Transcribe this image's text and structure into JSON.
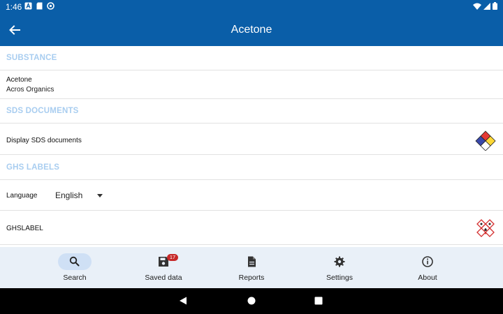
{
  "status_bar": {
    "time": "1:46"
  },
  "app_bar": {
    "title": "Acetone",
    "back_icon": "arrow-back-icon"
  },
  "sections": {
    "substance": {
      "header": "SUBSTANCE",
      "name": "Acetone",
      "supplier": "Acros Organics"
    },
    "sds": {
      "header": "SDS DOCUMENTS",
      "row_label": "Display SDS documents",
      "icon": "nfpa-diamond-icon"
    },
    "ghs": {
      "header": "GHS LABELS",
      "language_label": "Language",
      "language_value": "English",
      "label_row": "GHSLABEL",
      "icon": "ghs-pictogram-icon"
    }
  },
  "bottom_nav": {
    "items": [
      {
        "label": "Search",
        "icon": "search-icon",
        "active": true
      },
      {
        "label": "Saved data",
        "icon": "save-icon",
        "badge": "17"
      },
      {
        "label": "Reports",
        "icon": "document-icon"
      },
      {
        "label": "Settings",
        "icon": "gear-icon"
      },
      {
        "label": "About",
        "icon": "info-icon"
      }
    ]
  },
  "colors": {
    "app_bar": "#0a5ea8",
    "section_header": "#a8cdf0",
    "bottom_nav": "#e9f0f8",
    "badge": "#c62828"
  }
}
